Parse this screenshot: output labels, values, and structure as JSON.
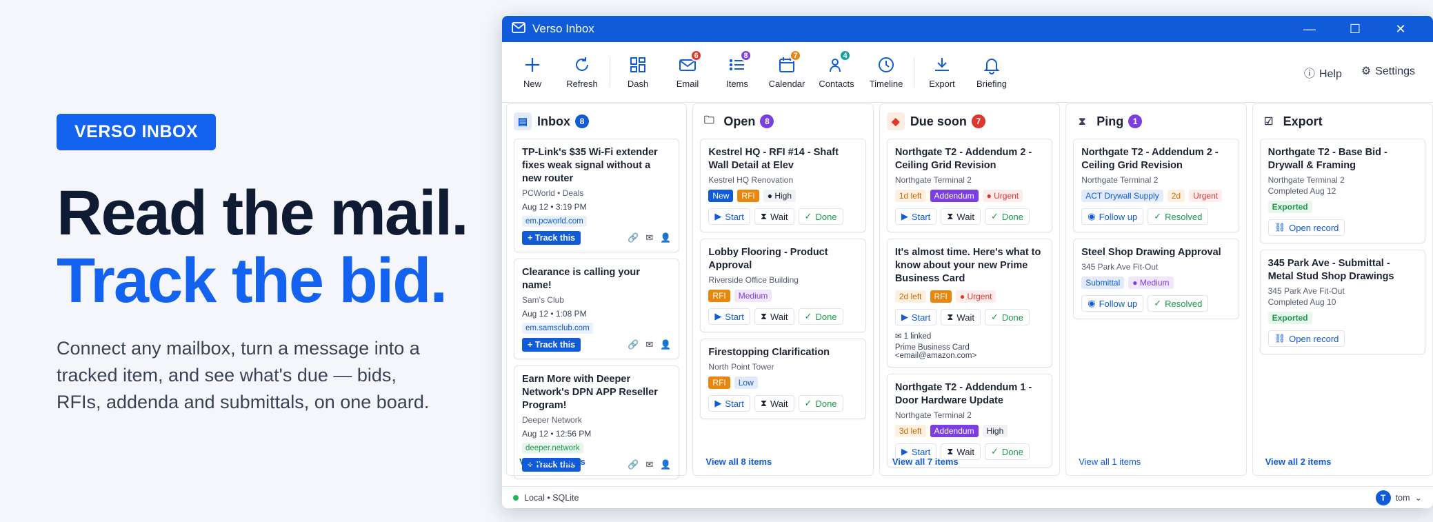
{
  "hero": {
    "badge": "VERSO INBOX",
    "headline1": "Read the mail.",
    "headline2": "Track the bid.",
    "description": "Connect any mailbox, turn a message into a tracked item, and see what's due — bids, RFIs, addenda and submittals, on one board."
  },
  "window": {
    "title": "Verso Inbox",
    "minimize": "—",
    "maximize": "☐",
    "close": "✕"
  },
  "toolbar": {
    "new": "New",
    "refresh": "Refresh",
    "dash": "Dash",
    "email": "Email",
    "email_count": "6",
    "items": "Items",
    "items_count": "8",
    "calendar": "Calendar",
    "calendar_count": "7",
    "contacts": "Contacts",
    "contacts_count": "4",
    "timeline": "Timeline",
    "export": "Export",
    "briefing": "Briefing",
    "help": "Help",
    "settings": "Settings"
  },
  "colors": {
    "accent": "#0f5bd8",
    "red": "#e0352b",
    "purple": "#7b3fe0",
    "orange": "#e8870f",
    "teal": "#12a29a",
    "green": "#1a9a4a"
  },
  "inbox": {
    "title": "Inbox",
    "count": "8",
    "view_all": "View all 8 items",
    "cards": [
      {
        "title": "TP-Link's $35 Wi-Fi extender fixes weak signal without a new router",
        "sender": "PCWorld • Deals",
        "date": "Aug 12 • 3:19 PM",
        "domain": "em.pcworld.com",
        "action": "+ Track this"
      },
      {
        "title": "Clearance is calling your name!",
        "sender": "Sam's Club",
        "date": "Aug 12 • 1:08 PM",
        "domain": "em.samsclub.com",
        "action": "+ Track this"
      },
      {
        "title": "Earn More with Deeper Network's DPN APP Reseller Program!",
        "sender": "Deeper Network",
        "date": "Aug 12 • 12:56 PM",
        "domain": "deeper.network",
        "action": "+ Track this"
      }
    ]
  },
  "open": {
    "title": "Open",
    "count": "8",
    "view_all": "View all 8 items",
    "cards": [
      {
        "title": "Kestrel HQ - RFI #14 - Shaft Wall Detail at Elev",
        "project": "Kestrel HQ Renovation",
        "tags": [
          "New",
          "RFI",
          "● High"
        ],
        "b1": "Start",
        "b2": "Wait",
        "b3": "Done"
      },
      {
        "title": "Lobby Flooring - Product Approval",
        "project": "Riverside Office Building",
        "tags": [
          "RFI",
          "Medium"
        ],
        "b1": "Start",
        "b2": "Wait",
        "b3": "Done"
      },
      {
        "title": "Firestopping Clarification",
        "project": "North Point Tower",
        "tags": [
          "RFI",
          "Low"
        ],
        "b1": "Start",
        "b2": "Wait",
        "b3": "Done"
      }
    ]
  },
  "due": {
    "title": "Due soon",
    "count": "7",
    "view_all": "View all 7 items",
    "cards": [
      {
        "title": "Northgate T2 - Addendum 2 - Ceiling Grid Revision",
        "project": "Northgate Terminal 2",
        "tags": [
          "1d left",
          "Addendum",
          "● Urgent"
        ],
        "b1": "Start",
        "b2": "Wait",
        "b3": "Done"
      },
      {
        "title": "It's almost time. Here's what to know about your new Prime Business Card",
        "project": "",
        "tags": [
          "2d left",
          "RFI",
          "● Urgent"
        ],
        "b1": "Start",
        "b2": "Wait",
        "b3": "Done",
        "linked": "1 linked",
        "linked_from": "Prime Business Card <email@amazon.com>"
      },
      {
        "title": "Northgate T2 - Addendum 1 - Door Hardware Update",
        "project": "Northgate Terminal 2",
        "tags": [
          "3d left",
          "Addendum",
          "High"
        ],
        "b1": "Start",
        "b2": "Wait",
        "b3": "Done"
      }
    ]
  },
  "ping": {
    "title": "Ping",
    "count": "1",
    "view_all": "View all 1 items",
    "cards": [
      {
        "title": "Northgate T2 - Addendum 2 - Ceiling Grid Revision",
        "project": "Northgate Terminal 2",
        "tags": [
          "ACT Drywall Supply",
          "2d",
          "Urgent"
        ],
        "b1": "Follow up",
        "b2": "Resolved"
      },
      {
        "title": "Steel Shop Drawing Approval",
        "project": "345 Park Ave Fit-Out",
        "tags": [
          "Submittal",
          "● Medium"
        ],
        "b1": "Follow up",
        "b2": "Resolved"
      }
    ]
  },
  "export": {
    "title": "Export",
    "view_all": "View all 2 items",
    "cards": [
      {
        "title": "Northgate T2 - Base Bid - Drywall & Framing",
        "project": "Northgate Terminal 2",
        "completed": "Completed Aug 12",
        "status": "Exported",
        "action": "Open record"
      },
      {
        "title": "345 Park Ave - Submittal - Metal Stud Shop Drawings",
        "project": "345 Park Ave Fit-Out",
        "completed": "Completed Aug 10",
        "status": "Exported",
        "action": "Open record"
      }
    ]
  },
  "status": {
    "text": "Local • SQLite",
    "user_initial": "T",
    "user": "tom"
  }
}
